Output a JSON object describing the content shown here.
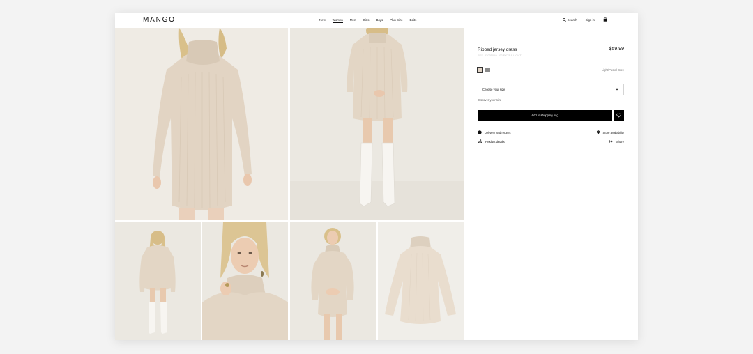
{
  "header": {
    "logo": "MANGO",
    "nav": [
      "New",
      "Women",
      "Men",
      "Girls",
      "Boys",
      "Plus Size",
      "Edits"
    ],
    "active_nav": "Women",
    "search_label": "Search",
    "signin_label": "Sign in"
  },
  "product": {
    "title": "Ribbed jersey dress",
    "subtitle": "REF. 33035019 - 02 EXTRA LIGHT",
    "price": "$59.99",
    "swatches": [
      {
        "name": "Light/Pastel Grey",
        "color": "#e2d5c6",
        "selected": true
      },
      {
        "name": "Grey",
        "color": "#8a8a8a",
        "selected": false
      }
    ],
    "color_name": "Light/Pastel Grey",
    "size_placeholder": "Choose your size",
    "discover_size": "Discover your size",
    "add_to_bag": "Add to shopping bag",
    "delivery": "Delivery and returns",
    "store": "Store availability",
    "details": "Product details",
    "share": "Share"
  },
  "colors": {
    "background": "#f3f3f3",
    "photo_bg": "#eeebe4",
    "sweater": "#e4d6c5",
    "button": "#000000"
  }
}
